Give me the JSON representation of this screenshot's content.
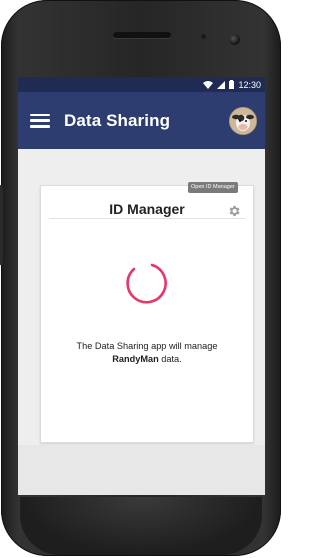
{
  "status_bar": {
    "time": "12:30"
  },
  "app_bar": {
    "title": "Data Sharing",
    "menu_icon": "menu-icon",
    "avatar_icon": "cow-avatar"
  },
  "card": {
    "title": "ID Manager",
    "tooltip": "Open ID Manager",
    "settings_icon": "gear-icon",
    "message_prefix": "The Data Sharing app will manage",
    "message_user": "RandyMan",
    "message_suffix": " data."
  },
  "colors": {
    "status_bar": "#1f2b52",
    "app_bar": "#2e3d70",
    "spinner": "#e8366a"
  }
}
